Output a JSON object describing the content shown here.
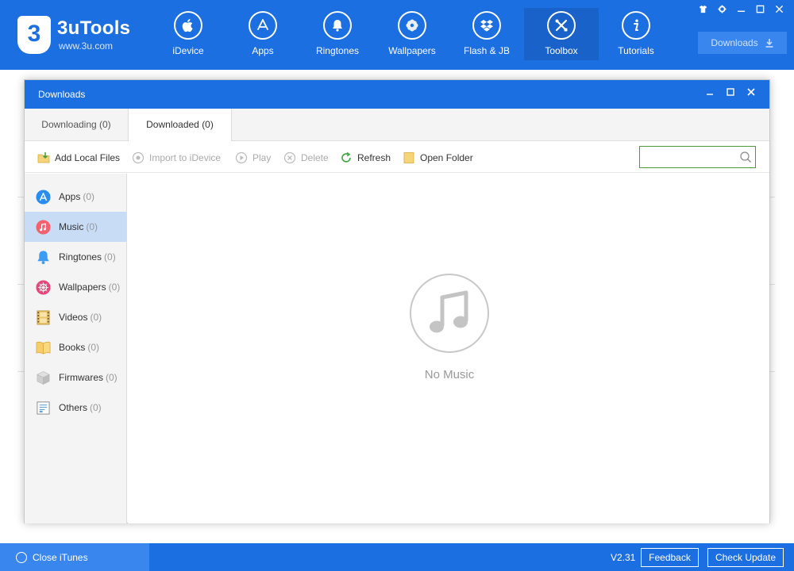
{
  "app": {
    "name": "3uTools",
    "url": "www.3u.com",
    "logo_glyph": "3"
  },
  "nav": [
    {
      "label": "iDevice",
      "icon": "apple-icon"
    },
    {
      "label": "Apps",
      "icon": "app-store-icon"
    },
    {
      "label": "Ringtones",
      "icon": "bell-icon"
    },
    {
      "label": "Wallpapers",
      "icon": "flower-icon"
    },
    {
      "label": "Flash & JB",
      "icon": "dropbox-icon"
    },
    {
      "label": "Toolbox",
      "icon": "tools-icon",
      "active": true
    },
    {
      "label": "Tutorials",
      "icon": "info-icon"
    }
  ],
  "header": {
    "downloads_label": "Downloads"
  },
  "dialog": {
    "title": "Downloads",
    "tabs": [
      {
        "label": "Downloading (0)"
      },
      {
        "label": "Downloaded (0)",
        "active": true
      }
    ],
    "toolbar": {
      "add_local_files": "Add Local Files",
      "import_to_idevice": "Import to iDevice",
      "play": "Play",
      "delete": "Delete",
      "refresh": "Refresh",
      "open_folder": "Open Folder",
      "search_placeholder": ""
    },
    "sidebar": [
      {
        "label": "Apps",
        "count": "(0)"
      },
      {
        "label": "Music",
        "count": "(0)",
        "active": true
      },
      {
        "label": "Ringtones",
        "count": "(0)"
      },
      {
        "label": "Wallpapers",
        "count": "(0)"
      },
      {
        "label": "Videos",
        "count": "(0)"
      },
      {
        "label": "Books",
        "count": "(0)"
      },
      {
        "label": "Firmwares",
        "count": "(0)"
      },
      {
        "label": "Others",
        "count": "(0)"
      }
    ],
    "empty_state": {
      "message": "No Music"
    }
  },
  "statusbar": {
    "close_itunes": "Close iTunes",
    "version": "V2.31",
    "feedback": "Feedback",
    "check_update": "Check Update"
  },
  "colors": {
    "primary": "#1c6fe0",
    "active_nav": "#1862c9",
    "sidebar_active": "#c9dcf5",
    "search_border": "#4c9a3c",
    "refresh_green": "#3aa83a"
  }
}
